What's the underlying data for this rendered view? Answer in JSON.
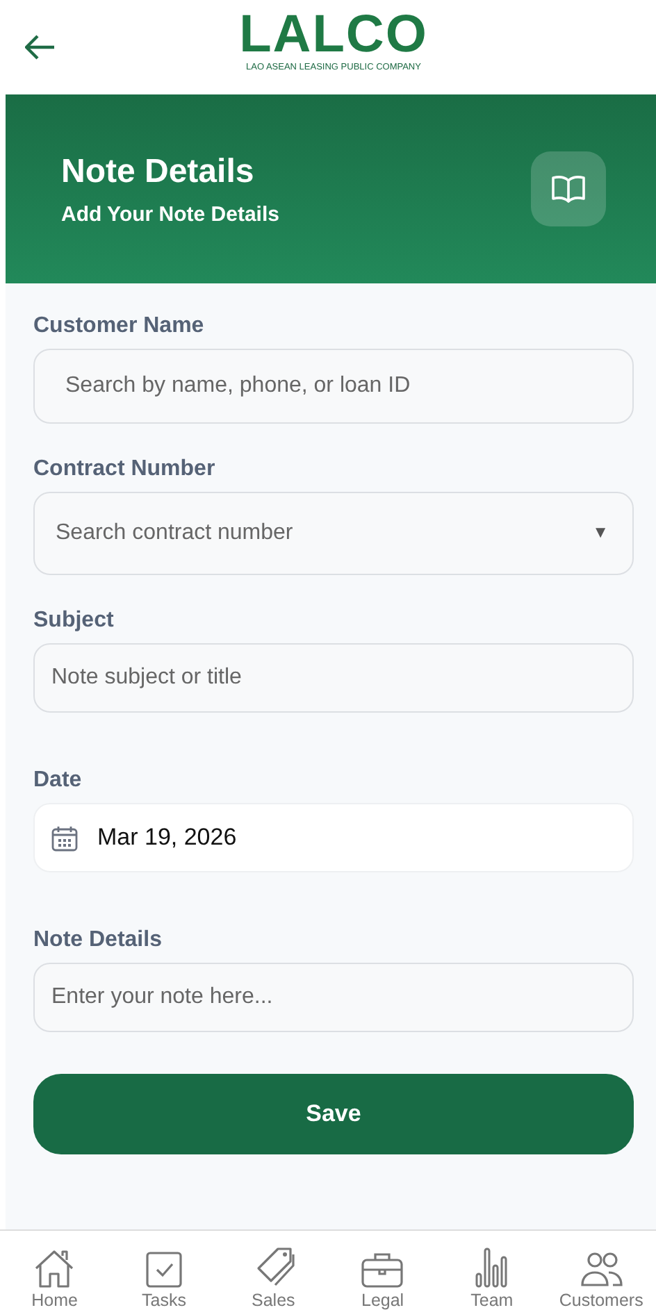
{
  "top_bar": {
    "logo": "LALCO",
    "logo_subtitle": "LAO ASEAN LEASING PUBLIC COMPANY"
  },
  "header": {
    "title": "Note Details",
    "subtitle": "Add Your Note Details"
  },
  "fields": [
    {
      "kind": "text",
      "label": "Customer Name",
      "placeholder": "Search by name, phone, or loan ID"
    },
    {
      "kind": "select",
      "label": "Contract Number",
      "placeholder": "Search contract number",
      "caret": "▼"
    },
    {
      "kind": "text",
      "label": "Subject",
      "placeholder": "Note subject or title"
    },
    {
      "kind": "date",
      "label": "Date",
      "value": "Mar 19, 2026"
    },
    {
      "kind": "text",
      "label": "Note Details",
      "placeholder": "Enter your note here..."
    }
  ],
  "save_button": "Save",
  "nav": [
    {
      "kind": "home",
      "label": "Home"
    },
    {
      "kind": "tasks",
      "label": "Tasks"
    },
    {
      "kind": "sales",
      "label": "Sales"
    },
    {
      "kind": "legal",
      "label": "Legal"
    },
    {
      "kind": "team",
      "label": "Team"
    },
    {
      "kind": "customers",
      "label": "Customers"
    }
  ]
}
